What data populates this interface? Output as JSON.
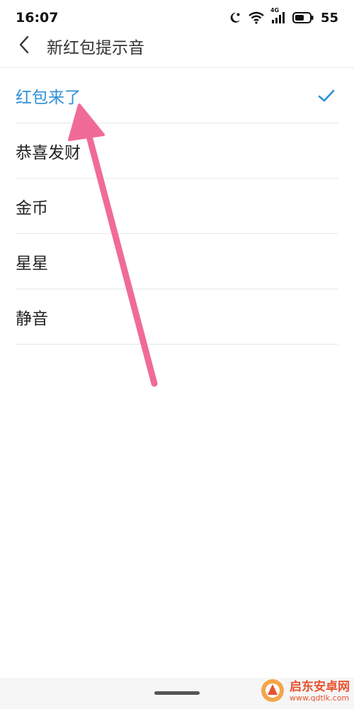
{
  "status_bar": {
    "time": "16:07",
    "network_type": "4G",
    "battery_level": "55",
    "icons": [
      "moon-icon",
      "wifi-icon",
      "signal-icon",
      "battery-icon"
    ]
  },
  "header": {
    "back_icon": "chevron-left-icon",
    "title": "新红包提示音"
  },
  "tones": {
    "items": [
      {
        "label": "红包来了",
        "selected": true
      },
      {
        "label": "恭喜发财",
        "selected": false
      },
      {
        "label": "金币",
        "selected": false
      },
      {
        "label": "星星",
        "selected": false
      },
      {
        "label": "静音",
        "selected": false
      }
    ],
    "selected_icon": "checkmark-icon"
  },
  "watermark": {
    "title": "启东安卓网",
    "url": "www.qdtlk.com"
  },
  "colors": {
    "accent": "#2d8fd6",
    "annotation_arrow": "#f06b98",
    "watermark": "#e8532f"
  }
}
